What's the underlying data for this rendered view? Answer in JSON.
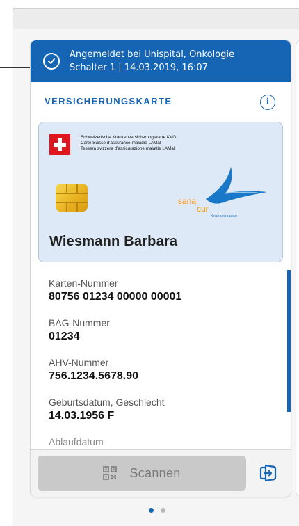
{
  "banner": {
    "line1": "Angemeldet bei Unispital, Onkologie",
    "line2": "Schalter 1 | 14.03.2019, 16:07",
    "icon": "check-circle-icon"
  },
  "section": {
    "title": "VERSICHERUNGSKARTE",
    "info_icon": "i"
  },
  "insurance_card": {
    "kvg_line1": "Schweizerische Krankenversicherungskarte KVG",
    "kvg_line2": "Carte Suisse d'assurance-maladie LAMal",
    "kvg_line3": "Tessera svizzera d'assicurazione malattie LAMal",
    "brand_sana": "sana",
    "brand_cur": "cur",
    "brand_sub": "Krankenkasse",
    "holder": "Wiesmann Barbara"
  },
  "fields": [
    {
      "label": "Karten-Nummer",
      "value": "80756 01234 00000 00001"
    },
    {
      "label": "BAG-Nummer",
      "value": "01234"
    },
    {
      "label": "AHV-Nummer",
      "value": "756.1234.5678.90"
    },
    {
      "label": "Geburtsdatum, Geschlecht",
      "value": "14.03.1956 F"
    },
    {
      "label": "Ablaufdatum",
      "value": ""
    }
  ],
  "actions": {
    "scan_label": "Scannen",
    "scan_icon": "qr-code-icon",
    "logout_icon": "logout-icon"
  },
  "pager": {
    "count": 2,
    "active": 0
  },
  "colors": {
    "accent": "#1565b4",
    "brand_orange": "#f39a1c",
    "disabled_button": "#c9c9c9"
  }
}
